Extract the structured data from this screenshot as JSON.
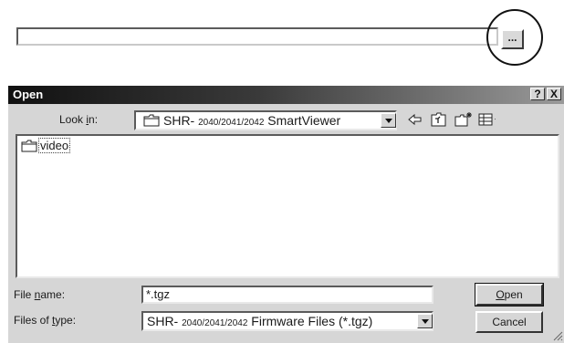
{
  "top": {
    "browse_label": "..."
  },
  "dialog": {
    "title": "Open",
    "help_glyph": "?",
    "close_glyph": "X",
    "look_in_label_pre": "Look ",
    "look_in_label_key": "i",
    "look_in_label_post": "n:",
    "look_in_value": {
      "prefix": "SHR- ",
      "models": "2040/2041/2042",
      "suffix": " SmartViewer"
    },
    "toolbar_icons": [
      "back-arrow-icon",
      "up-one-level-icon",
      "new-folder-icon",
      "view-menu-icon"
    ],
    "files": [
      {
        "name": "video",
        "icon": "folder-icon"
      }
    ],
    "file_name_label_pre": "File ",
    "file_name_label_key": "n",
    "file_name_label_post": "ame:",
    "file_name_value": "*.tgz",
    "file_type_label_pre": "Files of ",
    "file_type_label_key": "t",
    "file_type_label_post": "ype:",
    "file_type_value": {
      "prefix": "SHR- ",
      "models": "2040/2041/2042",
      "suffix": " Firmware Files (*.tgz)"
    },
    "open_label_key": "O",
    "open_label_rest": "pen",
    "cancel_label": "Cancel"
  },
  "colors": {
    "titlebar_start": "#111111",
    "titlebar_end": "#9a9a9a",
    "face": "#d6d6d6"
  }
}
